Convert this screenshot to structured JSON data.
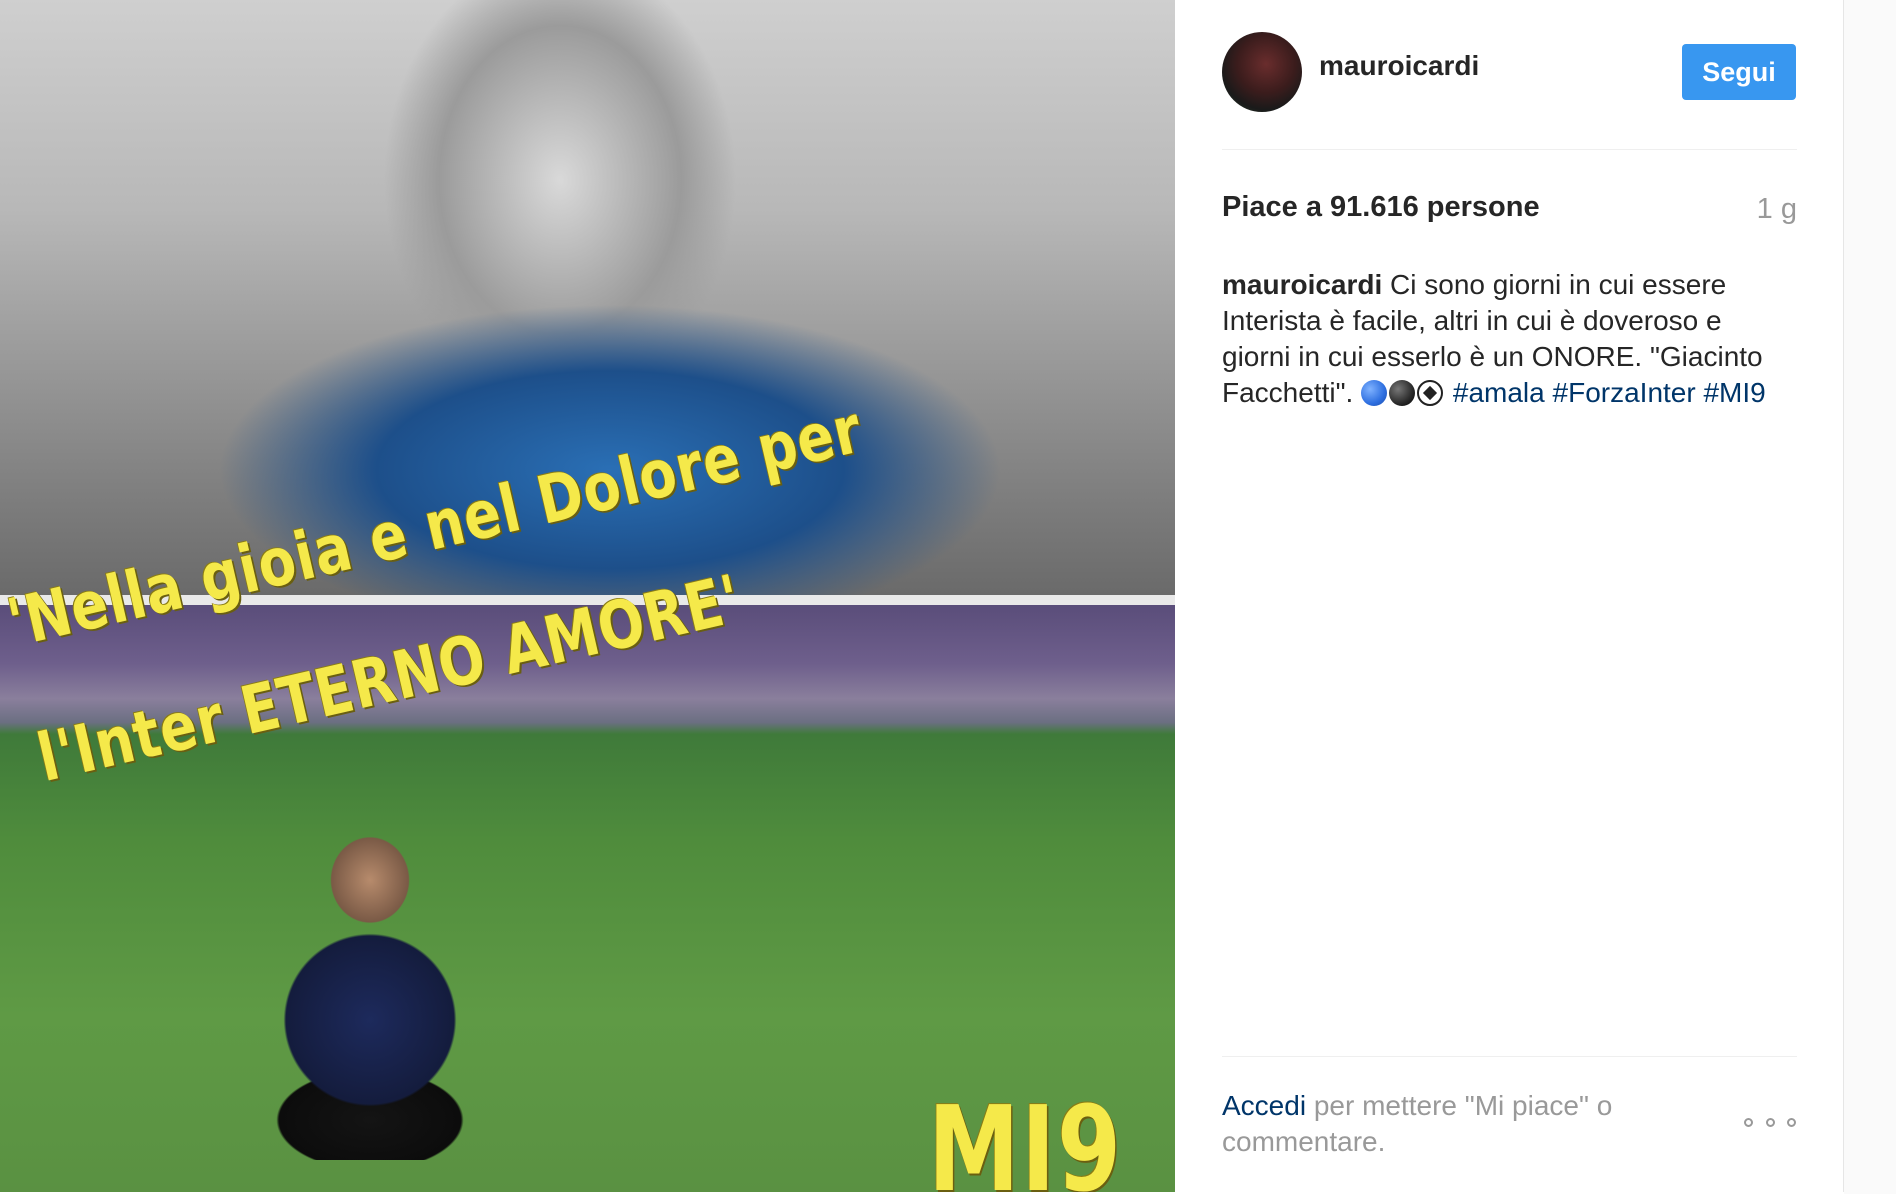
{
  "post": {
    "photo": {
      "overlay_line1": "'Nella gioia e nel Dolore per",
      "overlay_line2": "l'Inter ETERNO AMORE'",
      "overlay_tag": "MI9"
    },
    "header": {
      "username": "mauroicardi",
      "follow_label": "Segui"
    },
    "likes_text": "Piace a 91.616 persone",
    "timestamp": "1 g",
    "caption": {
      "username": "mauroicardi",
      "text_part1": " Ci sono giorni in cui essere Interista è facile, altri in cui è doveroso e giorni in cui esserlo è un ONORE. \"Giacinto Facchetti\". ",
      "emojis": [
        "blue-circle",
        "black-circle",
        "soccer-ball"
      ],
      "hashtags": [
        "#amala",
        "#ForzaInter",
        "#MI9"
      ]
    },
    "footer": {
      "login_link": "Accedi",
      "login_text": " per mettere \"Mi piace\" o commentare."
    },
    "colors": {
      "follow_button": "#3897f0",
      "hashtag": "#003569",
      "overlay_text": "#f5e94a"
    }
  }
}
